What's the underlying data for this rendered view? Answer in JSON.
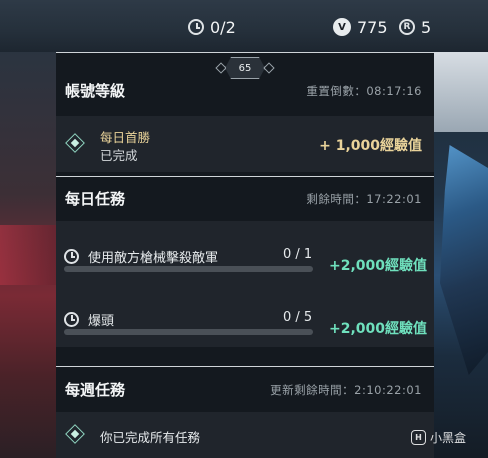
{
  "currency": {
    "missions_done": "0/2",
    "vp": "775",
    "vp_icon_letter": "V",
    "radianite": "5",
    "radianite_icon_letter": "R"
  },
  "account": {
    "level": "65",
    "title": "帳號等級",
    "reset_label": "重置倒數：08:17:16",
    "first_win": {
      "name": "每日首勝",
      "status": "已完成",
      "reward": "+ 1,000經驗值"
    }
  },
  "daily": {
    "title": "每日任務",
    "time_label": "剩餘時間：17:22:01",
    "missions": [
      {
        "label": "使用敵方槍械擊殺敵軍",
        "progress_text": "0 / 1",
        "progress": 0,
        "reward": "+2,000經驗值"
      },
      {
        "label": "爆頭",
        "progress_text": "0 / 5",
        "progress": 0,
        "reward": "+2,000經驗值"
      }
    ]
  },
  "weekly": {
    "title": "每週任務",
    "time_label": "更新剩餘時間：2:10:22:01",
    "status": "你已完成所有任務"
  },
  "watermark": {
    "text": "小黑盒",
    "logo_letter": "H"
  },
  "colors": {
    "accent_gold": "#e9d39a",
    "accent_teal": "#6fe0bd"
  }
}
